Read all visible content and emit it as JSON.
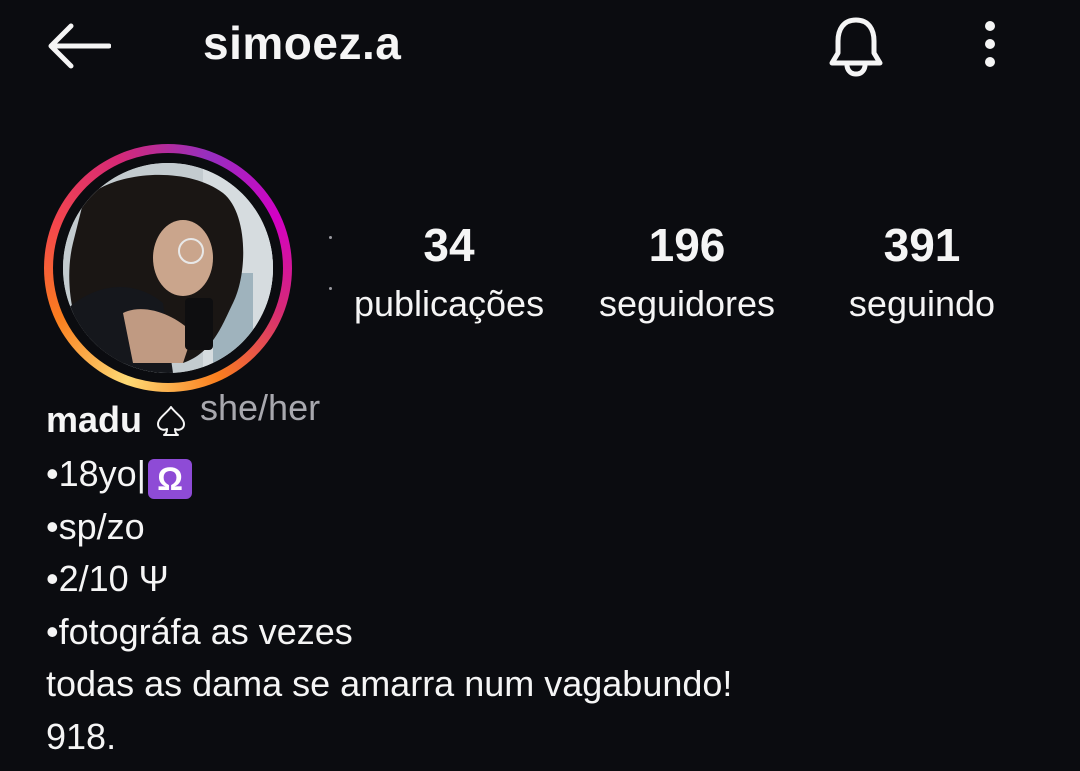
{
  "header": {
    "username": "simoez.a"
  },
  "stats": {
    "posts": {
      "value": "34",
      "label": "publicações"
    },
    "followers": {
      "value": "196",
      "label": "seguidores"
    },
    "following": {
      "value": "391",
      "label": "seguindo"
    }
  },
  "profile": {
    "display_name": "madu",
    "pronouns": "she/her",
    "bio_line1_text": "•18yo|",
    "bio_line1_emoji": "Ω",
    "bio_lines": [
      "•sp/zo",
      "•2/10 Ψ",
      "•fotográfa as vezes",
      "todas as dama se amarra num vagabundo!",
      "918."
    ]
  },
  "icons": {
    "back": "arrow-left-icon",
    "notifications": "bell-icon",
    "more": "more-vertical-icon",
    "name_emoji": "spade-outline-icon",
    "libra_emoji_color": "#8e4bd6"
  },
  "colors": {
    "background": "#0b0c10",
    "text": "#f5f5f5",
    "muted": "#a8a8ae"
  }
}
